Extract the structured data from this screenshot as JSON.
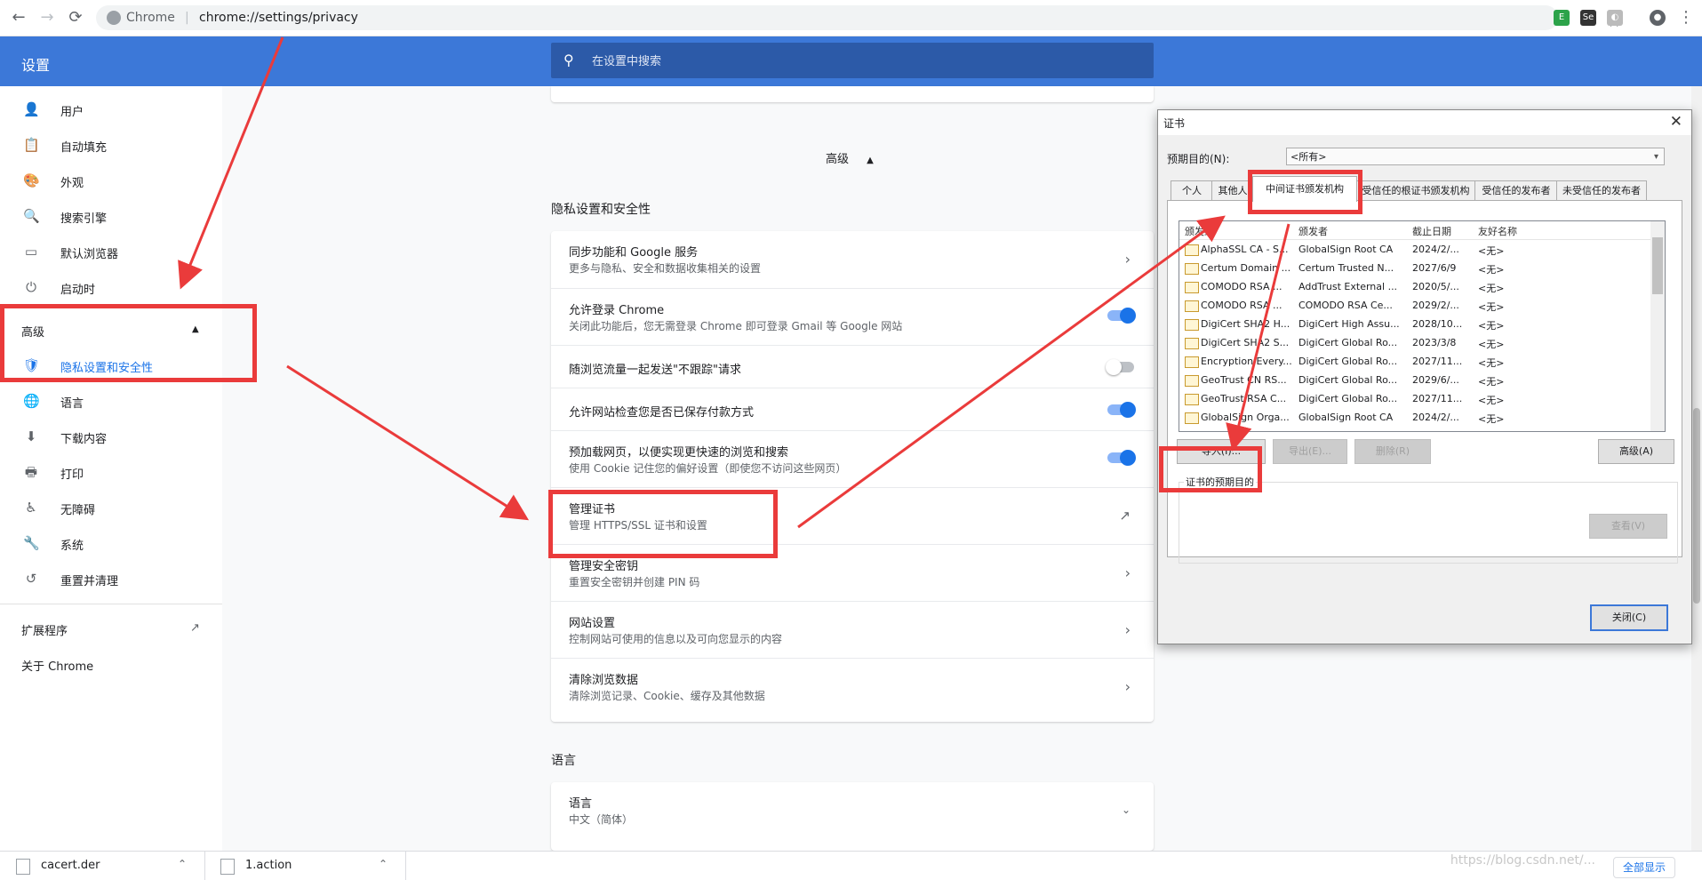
{
  "browser": {
    "site_name": "Chrome",
    "url": "chrome://settings/privacy",
    "back": "←",
    "forward": "→",
    "reload": "⟳",
    "star": "☆",
    "menu": "⋮"
  },
  "header": {
    "title": "设置",
    "search_placeholder": "在设置中搜索"
  },
  "sidebar": {
    "items": [
      {
        "label": "用户",
        "icon": "👤"
      },
      {
        "label": "自动填充",
        "icon": "📋"
      },
      {
        "label": "外观",
        "icon": "🎨"
      },
      {
        "label": "搜索引擎",
        "icon": "🔍"
      },
      {
        "label": "默认浏览器",
        "icon": "▭"
      },
      {
        "label": "启动时",
        "icon": "⏻"
      }
    ],
    "advanced": {
      "label": "高级",
      "arrow": "▲"
    },
    "advanced_items": [
      {
        "label": "隐私设置和安全性",
        "icon": "🛡"
      },
      {
        "label": "语言",
        "icon": "🌐"
      },
      {
        "label": "下载内容",
        "icon": "⬇"
      },
      {
        "label": "打印",
        "icon": "🖶"
      },
      {
        "label": "无障碍",
        "icon": "♿"
      },
      {
        "label": "系统",
        "icon": "🔧"
      },
      {
        "label": "重置并清理",
        "icon": "↺"
      }
    ],
    "extensions": {
      "label": "扩展程序",
      "icon": "↗"
    },
    "about": {
      "label": "关于 Chrome"
    }
  },
  "main": {
    "advanced_toggle": {
      "label": "高级",
      "arrow": "▲"
    },
    "privacy_section_title": "隐私设置和安全性",
    "privacy_rows": [
      {
        "title": "同步功能和 Google 服务",
        "sub": "更多与隐私、安全和数据收集相关的设置",
        "control": "chevron"
      },
      {
        "title": "允许登录 Chrome",
        "sub": "关闭此功能后，您无需登录 Chrome 即可登录 Gmail 等 Google 网站",
        "control": "toggle",
        "on": true
      },
      {
        "title": "随浏览流量一起发送\"不跟踪\"请求",
        "sub": "",
        "control": "toggle",
        "on": false
      },
      {
        "title": "允许网站检查您是否已保存付款方式",
        "sub": "",
        "control": "toggle",
        "on": true
      },
      {
        "title": "预加载网页，以便实现更快速的浏览和搜索",
        "sub": "使用 Cookie 记住您的偏好设置（即使您不访问这些网页）",
        "control": "toggle",
        "on": true
      },
      {
        "title": "管理证书",
        "sub": "管理 HTTPS/SSL 证书和设置",
        "control": "external"
      },
      {
        "title": "管理安全密钥",
        "sub": "重置安全密钥并创建 PIN 码",
        "control": "chevron"
      },
      {
        "title": "网站设置",
        "sub": "控制网站可使用的信息以及可向您显示的内容",
        "control": "chevron"
      },
      {
        "title": "清除浏览数据",
        "sub": "清除浏览记录、Cookie、缓存及其他数据",
        "control": "chevron"
      }
    ],
    "language_section_title": "语言",
    "language_row": {
      "title": "语言",
      "sub": "中文（简体）"
    }
  },
  "dialog": {
    "title": "证书",
    "purpose_label": "预期目的(N):",
    "purpose_value": "<所有>",
    "tabs": [
      "个人",
      "其他人",
      "中间证书颁发机构",
      "受信任的根证书颁发机构",
      "受信任的发布者",
      "未受信任的发布者"
    ],
    "active_tab": 2,
    "columns": [
      "颁发给",
      "颁发者",
      "截止日期",
      "友好名称"
    ],
    "certs": [
      {
        "to": "AlphaSSL CA - S...",
        "by": "GlobalSign Root CA",
        "exp": "2024/2/...",
        "name": "<无>"
      },
      {
        "to": "Certum Domain ...",
        "by": "Certum Trusted N...",
        "exp": "2027/6/9",
        "name": "<无>"
      },
      {
        "to": "COMODO RSA ...",
        "by": "AddTrust External ...",
        "exp": "2020/5/...",
        "name": "<无>"
      },
      {
        "to": "COMODO RSA ...",
        "by": "COMODO RSA Ce...",
        "exp": "2029/2/...",
        "name": "<无>"
      },
      {
        "to": "DigiCert SHA2 H...",
        "by": "DigiCert High Assu...",
        "exp": "2028/10...",
        "name": "<无>"
      },
      {
        "to": "DigiCert SHA2 S...",
        "by": "DigiCert Global Ro...",
        "exp": "2023/3/8",
        "name": "<无>"
      },
      {
        "to": "Encryption Every...",
        "by": "DigiCert Global Ro...",
        "exp": "2027/11...",
        "name": "<无>"
      },
      {
        "to": "GeoTrust CN RS...",
        "by": "DigiCert Global Ro...",
        "exp": "2029/6/...",
        "name": "<无>"
      },
      {
        "to": "GeoTrust RSA C...",
        "by": "DigiCert Global Ro...",
        "exp": "2027/11...",
        "name": "<无>"
      },
      {
        "to": "GlobalSign Orga...",
        "by": "GlobalSign Root CA",
        "exp": "2024/2/...",
        "name": "<无>"
      }
    ],
    "buttons": {
      "import": "导入(I)...",
      "export": "导出(E)...",
      "remove": "删除(R)",
      "advanced": "高级(A)"
    },
    "purpose_box_label": "证书的预期目的",
    "view_button": "查看(V)",
    "close_button": "关闭(C)"
  },
  "downloads": {
    "items": [
      {
        "name": "cacert.der"
      },
      {
        "name": "1.action"
      }
    ],
    "show_all": "全部显示"
  },
  "watermark": "https://blog.csdn.net/...",
  "colors": {
    "header_blue": "#3c78d8",
    "accent": "#1a73e8",
    "annotation_red": "#ea3b3b"
  }
}
